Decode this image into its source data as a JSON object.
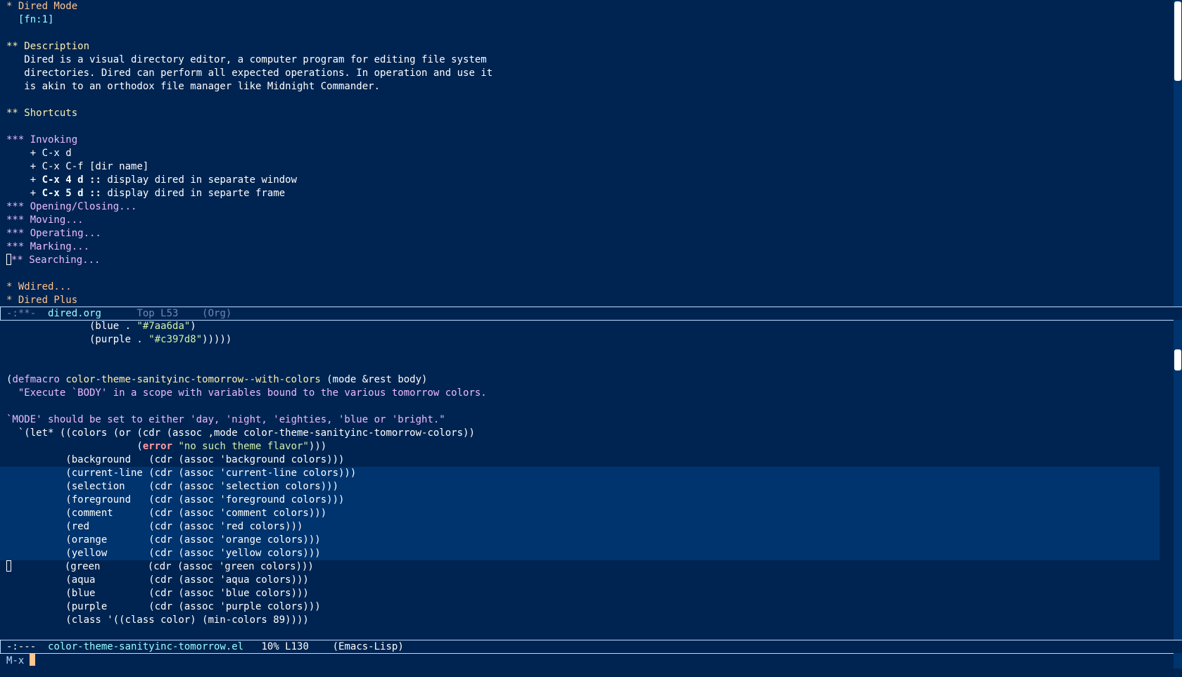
{
  "top_buffer": {
    "lines": [
      {
        "stars": "* ",
        "text": "Dired Mode"
      },
      {
        "footnote": "  [fn:1]"
      },
      {
        "blank": ""
      },
      {
        "stars": "** ",
        "text": "Description"
      },
      {
        "body": "   Dired is a visual directory editor, a computer program for editing file system"
      },
      {
        "body": "   directories. Dired can perform all expected operations. In operation and use it"
      },
      {
        "body": "   is akin to an orthodox file manager like Midnight Commander."
      },
      {
        "blank": ""
      },
      {
        "stars": "** ",
        "text": "Shortcuts"
      },
      {
        "blank": ""
      },
      {
        "stars": "*** ",
        "text": "Invoking"
      },
      {
        "item_prefix": "    + ",
        "item_text": "C-x d"
      },
      {
        "item_prefix": "    + ",
        "item_text": "C-x C-f [dir name]"
      },
      {
        "item_prefix": "    + ",
        "item_key": "C-x 4 d",
        "item_sep": " :: ",
        "item_desc": "display dired in separate window"
      },
      {
        "item_prefix": "    + ",
        "item_key": "C-x 5 d",
        "item_sep": " :: ",
        "item_desc": "display dired in separte frame"
      },
      {
        "stars": "*** ",
        "text": "Opening/Closing..."
      },
      {
        "stars": "*** ",
        "text": "Moving..."
      },
      {
        "stars": "*** ",
        "text": "Operating..."
      },
      {
        "stars": "*** ",
        "text": "Marking..."
      },
      {
        "stars_cursor_rest": "** ",
        "text": "Searching..."
      },
      {
        "blank": ""
      },
      {
        "stars": "* ",
        "text": "Wdired..."
      },
      {
        "stars": "* ",
        "text": "Dired Plus"
      }
    ]
  },
  "top_modeline": {
    "flags": "-:**-  ",
    "buffer_name": "dired.org",
    "position": "      Top L53    ",
    "mode": "(Org)"
  },
  "bottom_buffer": {
    "line_blue": {
      "indent": "              (blue . ",
      "value": "\"#7aa6da\"",
      "close": ")"
    },
    "line_purple": {
      "indent": "              (purple . ",
      "value": "\"#c397d8\"",
      "close": ")))))"
    },
    "defmacro": {
      "open": "(",
      "keyword": "defmacro",
      "name": "color-theme-sanityinc-tomorrow--with-colors",
      "args": " (mode &rest body)"
    },
    "doc_line_1": "  \"Execute `BODY' in a scope with variables bound to the various tomorrow colors.",
    "doc_line_2": "`MODE' should be set to either 'day, 'night, 'eighties, 'blue or 'bright.\"",
    "let_line": "  `(let* ((colors (or (cdr (assoc ,mode color-theme-sanityinc-tomorrow-colors))",
    "error_line": {
      "indent": "                      (",
      "fn": "error",
      "space": " ",
      "str": "\"no such theme flavor\"",
      "close": ")))"
    },
    "bindings": [
      {
        "text": "          (background   (cdr (assoc 'background colors)))",
        "highlight": false
      },
      {
        "text": "          (current-line (cdr (assoc 'current-line colors)))",
        "highlight": true
      },
      {
        "text": "          (selection    (cdr (assoc 'selection colors)))",
        "highlight": true
      },
      {
        "text": "          (foreground   (cdr (assoc 'foreground colors)))",
        "highlight": true
      },
      {
        "text": "          (comment      (cdr (assoc 'comment colors)))",
        "highlight": true
      },
      {
        "text": "          (red          (cdr (assoc 'red colors)))",
        "highlight": true
      },
      {
        "text": "          (orange       (cdr (assoc 'orange colors)))",
        "highlight": true
      },
      {
        "text": "          (yellow       (cdr (assoc 'yellow colors)))",
        "highlight": true
      },
      {
        "text": "         (green        (cdr (assoc 'green colors)))",
        "highlight": false,
        "cursor": true
      },
      {
        "text": "          (aqua         (cdr (assoc 'aqua colors)))",
        "highlight": false
      },
      {
        "text": "          (blue         (cdr (assoc 'blue colors)))",
        "highlight": false
      },
      {
        "text": "          (purple       (cdr (assoc 'purple colors)))",
        "highlight": false
      },
      {
        "text": "          (class '((class color) (min-colors 89))))",
        "highlight": false
      }
    ]
  },
  "bottom_modeline": {
    "flags": "-:---  ",
    "buffer_name": "color-theme-sanityinc-tomorrow.el",
    "position": "   10% L130    ",
    "mode": "(Emacs-Lisp)"
  },
  "echo_area": {
    "prompt": "M-x"
  },
  "colors": {
    "background": "#002451",
    "foreground": "#ffffff",
    "highlight": "#00346e",
    "heading_1": "#ffc58f",
    "heading_2": "#ffeead",
    "heading_3": "#ebbbff",
    "string": "#d1f1a9"
  }
}
